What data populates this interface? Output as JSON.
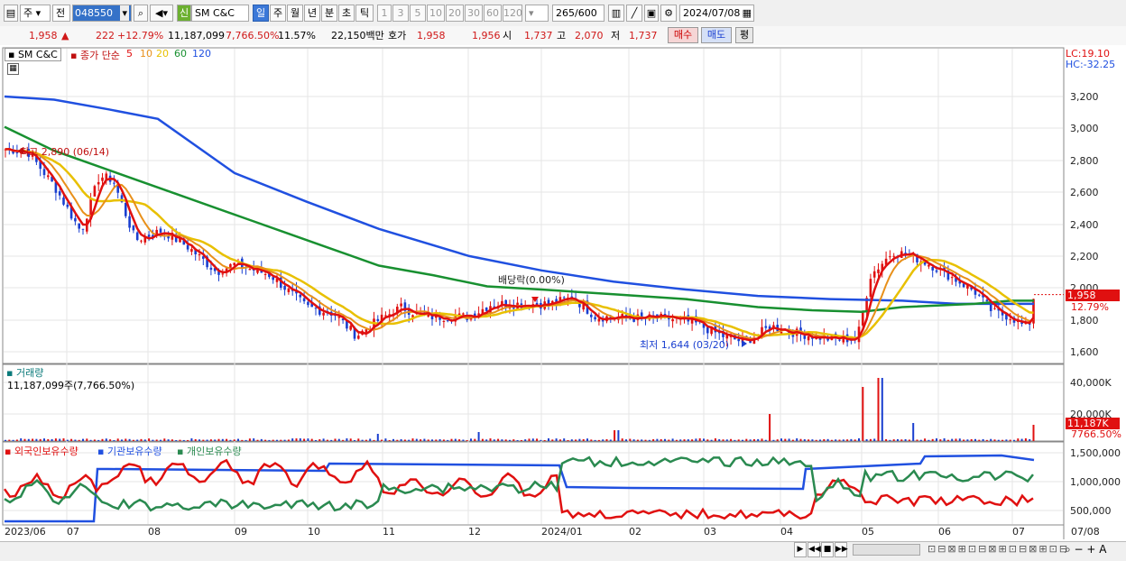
{
  "toolbar": {
    "market": "주",
    "period_mode": "전",
    "code": "048550",
    "badge": "신",
    "name": "SM C&C",
    "timeframes": [
      "일",
      "주",
      "월",
      "년",
      "분",
      "초",
      "틱"
    ],
    "active_timeframe": "일",
    "intervals": [
      "1",
      "3",
      "5",
      "10",
      "20",
      "30",
      "60",
      "120"
    ],
    "range": "265",
    "range_total": "/600",
    "date": "2024/07/08"
  },
  "quote": {
    "price": "1,958",
    "arrow": "▲",
    "change": "222",
    "change_pct": "+12.79%",
    "volume": "11,187,099",
    "volume_pct": "7,766.50%",
    "turnover": "11.57%",
    "amount": "22,150백만",
    "bid_label": "호가",
    "ask": "1,958",
    "bid": "1,956",
    "open_label": "시",
    "open": "1,737",
    "high_label": "고",
    "high": "2,070",
    "low_label": "저",
    "low": "1,737",
    "buy_button": "매수",
    "sell_button": "매도",
    "eval_button": "평"
  },
  "price_panel": {
    "symbol": "SM C&C",
    "indicator": "종가 단순",
    "ma_labels": [
      "5",
      "10",
      "20",
      "60",
      "120"
    ],
    "ma_colors": [
      "#e01010",
      "#e8901a",
      "#e8c000",
      "#189030",
      "#2050e0"
    ],
    "lc": "LC:19.10",
    "hc": "HC:-32.25",
    "high_note": "최고 2,890 (06/14)",
    "low_note": "최저 1,644 (03/20)",
    "dividend_note": "배당락(0.00%)",
    "last_price": "1,958",
    "last_pct": "12.79%",
    "y_ticks": [
      "3,200",
      "3,000",
      "2,800",
      "2,600",
      "2,400",
      "2,200",
      "2,000",
      "1,800",
      "1,600"
    ]
  },
  "volume_panel": {
    "title": "거래량",
    "value": "11,187,099주(7,766.50%)",
    "y_ticks": [
      "40,000K",
      "20,000K"
    ],
    "last": "11,187K",
    "last_pct": "7766.50%"
  },
  "holding_panel": {
    "legend": [
      "외국인보유수량",
      "기관보유수량",
      "개인보유수량"
    ],
    "colors": [
      "#e01010",
      "#2050e0",
      "#2a8a50"
    ],
    "y_ticks": [
      "1,500,000",
      "1,000,000",
      "500,000"
    ]
  },
  "x_axis": {
    "labels": [
      "2023/06",
      "07",
      "08",
      "09",
      "10",
      "11",
      "12",
      "2024/01",
      "02",
      "03",
      "04",
      "05",
      "06",
      "07"
    ],
    "right_label": "07/08"
  }
}
